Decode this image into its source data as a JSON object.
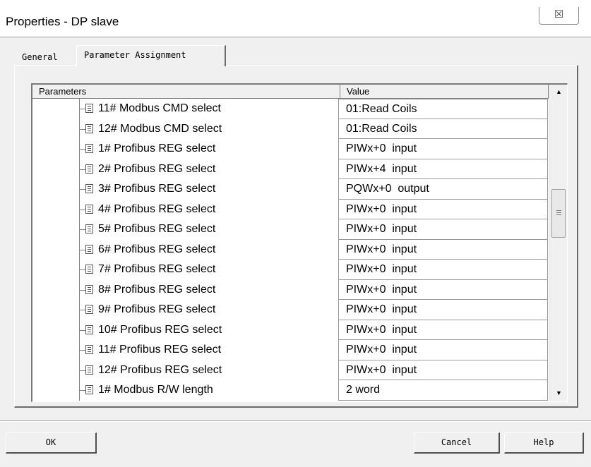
{
  "window": {
    "title": "Properties - DP slave",
    "close_label": "☒"
  },
  "tabs": [
    {
      "label": "General",
      "active": false
    },
    {
      "label": "Parameter Assignment",
      "active": true
    }
  ],
  "grid": {
    "columns": {
      "parameters": "Parameters",
      "value": "Value"
    },
    "rows": [
      {
        "name": "11# Modbus CMD select",
        "value": "01:Read Coils"
      },
      {
        "name": "12# Modbus CMD select",
        "value": "01:Read Coils"
      },
      {
        "name": "1# Profibus REG select",
        "value": "PIWx+0  input"
      },
      {
        "name": "2# Profibus REG select",
        "value": "PIWx+4  input"
      },
      {
        "name": "3# Profibus REG select",
        "value": "PQWx+0  output"
      },
      {
        "name": "4# Profibus REG select",
        "value": "PIWx+0  input"
      },
      {
        "name": "5# Profibus REG select",
        "value": "PIWx+0  input"
      },
      {
        "name": "6# Profibus REG select",
        "value": "PIWx+0  input"
      },
      {
        "name": "7# Profibus REG select",
        "value": "PIWx+0  input"
      },
      {
        "name": "8# Profibus REG select",
        "value": "PIWx+0  input"
      },
      {
        "name": "9# Profibus REG select",
        "value": "PIWx+0  input"
      },
      {
        "name": "10# Profibus REG select",
        "value": "PIWx+0  input"
      },
      {
        "name": "11# Profibus REG select",
        "value": "PIWx+0  input"
      },
      {
        "name": "12# Profibus REG select",
        "value": "PIWx+0  input"
      },
      {
        "name": "1# Modbus R/W length",
        "value": "2 word"
      }
    ]
  },
  "buttons": {
    "ok": "OK",
    "cancel": "Cancel",
    "help": "Help"
  }
}
